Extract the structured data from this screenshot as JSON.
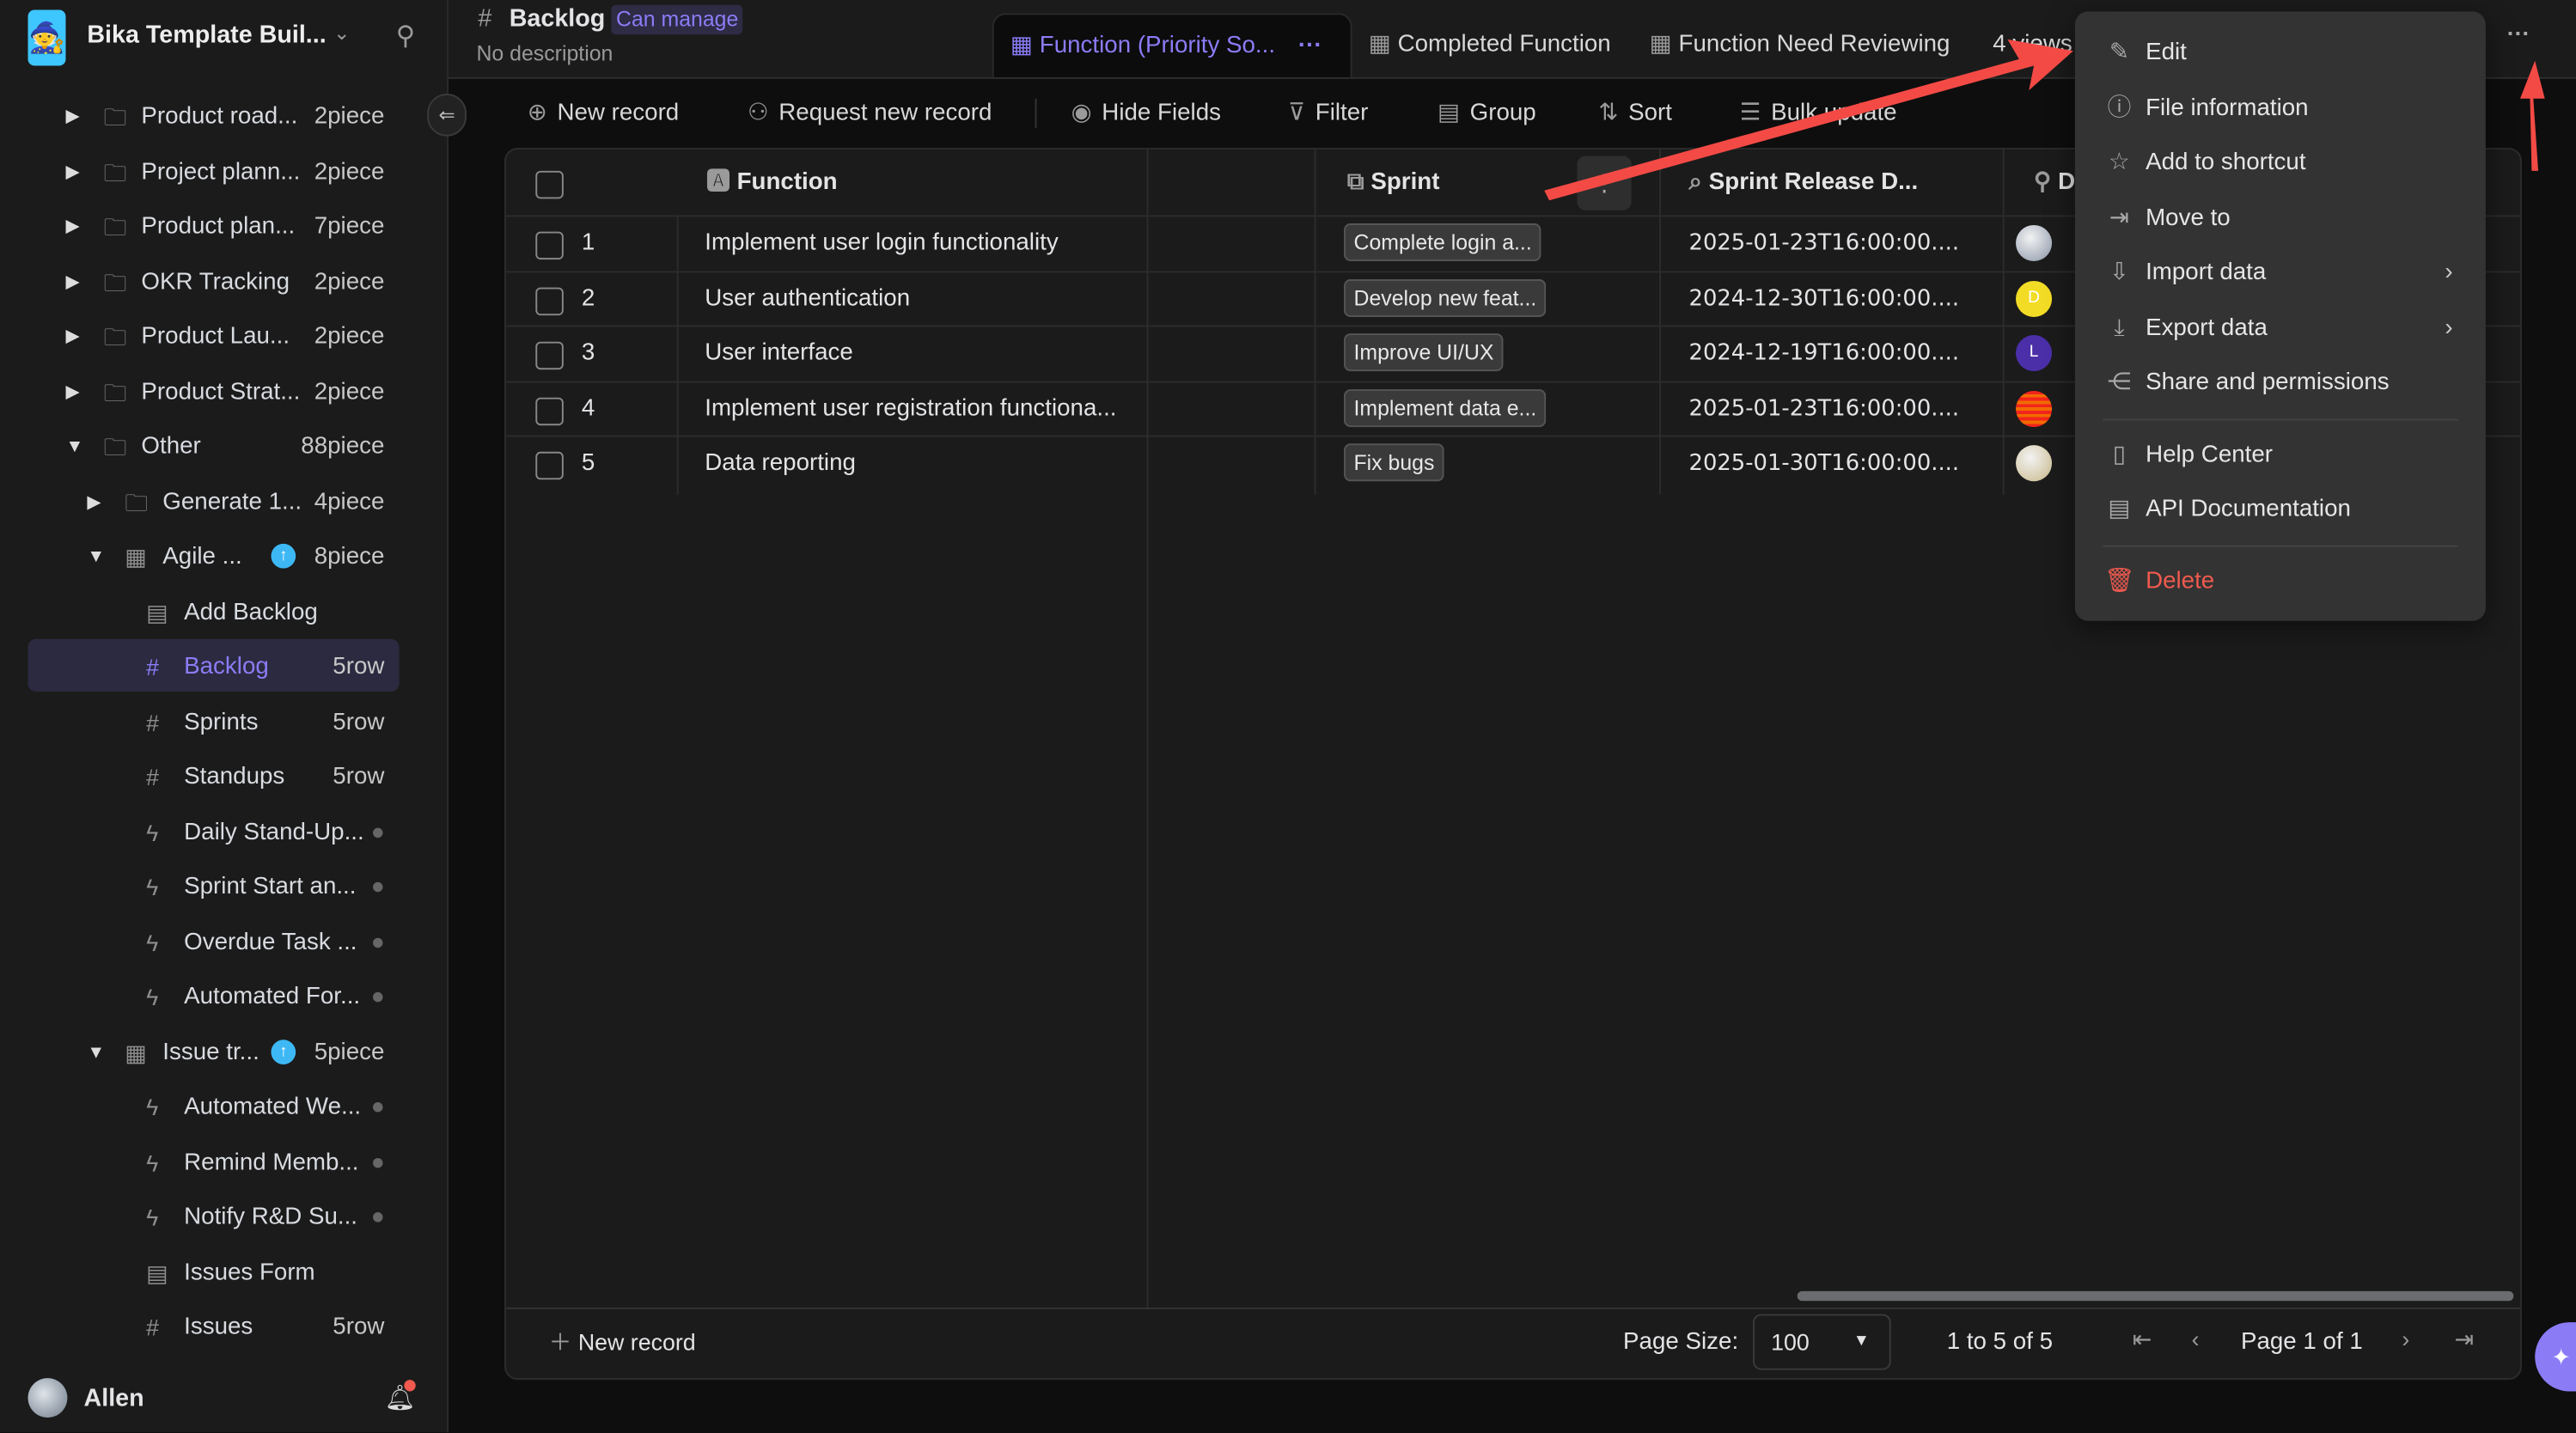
{
  "workspace": {
    "name": "Bika Template Buil...",
    "icon": "wizard-avatar"
  },
  "sidebar": {
    "items": [
      {
        "level": 0,
        "type": "folder",
        "expand": "collapsed",
        "label": "Product road...",
        "count": "2piece"
      },
      {
        "level": 0,
        "type": "folder",
        "expand": "collapsed",
        "label": "Project plann...",
        "count": "2piece"
      },
      {
        "level": 0,
        "type": "folder",
        "expand": "collapsed",
        "label": "Product plan...",
        "count": "7piece"
      },
      {
        "level": 0,
        "type": "folder",
        "expand": "collapsed",
        "label": "OKR Tracking",
        "count": "2piece"
      },
      {
        "level": 0,
        "type": "folder",
        "expand": "collapsed",
        "label": "Product Lau...",
        "count": "2piece"
      },
      {
        "level": 0,
        "type": "folder",
        "expand": "collapsed",
        "label": "Product Strat...",
        "count": "2piece"
      },
      {
        "level": 0,
        "type": "folder",
        "expand": "expanded",
        "label": "Other",
        "count": "88piece"
      },
      {
        "level": 1,
        "type": "folder",
        "expand": "collapsed",
        "label": "Generate 1...",
        "count": "4piece"
      },
      {
        "level": 1,
        "type": "app",
        "expand": "expanded",
        "label": "Agile ...",
        "count": "8piece",
        "upgrade": true
      },
      {
        "level": 2,
        "type": "form",
        "label": "Add Backlog"
      },
      {
        "level": 2,
        "type": "table",
        "label": "Backlog",
        "count": "5row",
        "selected": true
      },
      {
        "level": 2,
        "type": "table",
        "label": "Sprints",
        "count": "5row"
      },
      {
        "level": 2,
        "type": "table",
        "label": "Standups",
        "count": "5row"
      },
      {
        "level": 2,
        "type": "automation",
        "label": "Daily Stand-Up...",
        "dot": true
      },
      {
        "level": 2,
        "type": "automation",
        "label": "Sprint Start an...",
        "dot": true
      },
      {
        "level": 2,
        "type": "automation",
        "label": "Overdue Task ...",
        "dot": true
      },
      {
        "level": 2,
        "type": "automation",
        "label": "Automated For...",
        "dot": true
      },
      {
        "level": 1,
        "type": "app",
        "expand": "expanded",
        "label": "Issue tr...",
        "count": "5piece",
        "upgrade": true
      },
      {
        "level": 2,
        "type": "automation",
        "label": "Automated We...",
        "dot": true
      },
      {
        "level": 2,
        "type": "automation",
        "label": "Remind Memb...",
        "dot": true
      },
      {
        "level": 2,
        "type": "automation",
        "label": "Notify R&D Su...",
        "dot": true
      },
      {
        "level": 2,
        "type": "form",
        "label": "Issues Form"
      },
      {
        "level": 2,
        "type": "table",
        "label": "Issues",
        "count": "5row"
      }
    ],
    "user": {
      "name": "Allen",
      "notification_badge": true
    }
  },
  "header": {
    "title": "Backlog",
    "permission": "Can manage",
    "description": "No description"
  },
  "views": {
    "tabs": [
      {
        "label": "Function (Priority So...",
        "active": true
      },
      {
        "label": "Completed Function"
      },
      {
        "label": "Function Need Reviewing"
      }
    ],
    "more_views": "4 views"
  },
  "toolbar": {
    "new_record": "New record",
    "request_new_record": "Request new record",
    "hide_fields": "Hide Fields",
    "filter": "Filter",
    "group": "Group",
    "sort": "Sort",
    "bulk_update": "Bulk update"
  },
  "table": {
    "columns": [
      "Function",
      "",
      "Sprint",
      "Sprint Release D...",
      "D"
    ],
    "rows": [
      {
        "num": "1",
        "function": "Implement user login functionality",
        "sprint": "Complete login a...",
        "release": "2025-01-23T16:00:00....",
        "avatar": {
          "type": "photo",
          "color": "#8a96a8"
        }
      },
      {
        "num": "2",
        "function": "User authentication",
        "sprint": "Develop new feat...",
        "release": "2024-12-30T16:00:00....",
        "avatar": {
          "type": "letter",
          "letter": "D",
          "color": "#f3dc25"
        }
      },
      {
        "num": "3",
        "function": "User interface",
        "sprint": "Improve UI/UX",
        "release": "2024-12-19T16:00:00....",
        "avatar": {
          "type": "letter",
          "letter": "L",
          "color": "#4a2fa8"
        }
      },
      {
        "num": "4",
        "function": "Implement user registration functiona...",
        "sprint": "Implement data e...",
        "release": "2025-01-23T16:00:00....",
        "avatar": {
          "type": "pattern",
          "color": "#f26b00"
        }
      },
      {
        "num": "5",
        "function": "Data reporting",
        "sprint": "Fix bugs",
        "release": "2025-01-30T16:00:00....",
        "avatar": {
          "type": "photo",
          "color": "#c9b98a"
        }
      }
    ]
  },
  "footer": {
    "new_record": "New record",
    "page_size_label": "Page Size:",
    "page_size": "100",
    "range": "1 to 5 of 5",
    "page": "Page 1 of 1"
  },
  "menu": {
    "items": [
      {
        "icon": "pencil-icon",
        "label": "Edit"
      },
      {
        "icon": "info-icon",
        "label": "File information"
      },
      {
        "icon": "pin-icon",
        "label": "Add to shortcut"
      },
      {
        "icon": "move-folder-icon",
        "label": "Move to"
      },
      {
        "icon": "import-icon",
        "label": "Import data",
        "submenu": true
      },
      {
        "icon": "download-icon",
        "label": "Export data",
        "submenu": true
      },
      {
        "icon": "share-icon",
        "label": "Share and permissions"
      },
      {
        "icon": "book-icon",
        "label": "Help Center",
        "sep_before": true
      },
      {
        "icon": "document-icon",
        "label": "API Documentation"
      },
      {
        "icon": "trash-icon",
        "label": "Delete",
        "danger": true,
        "sep_before": true
      }
    ]
  },
  "colors": {
    "accent": "#8b7cf6",
    "danger": "#f05a4f",
    "annotation_arrow": "#f44a45",
    "upgrade_badge": "#3db8f5"
  }
}
